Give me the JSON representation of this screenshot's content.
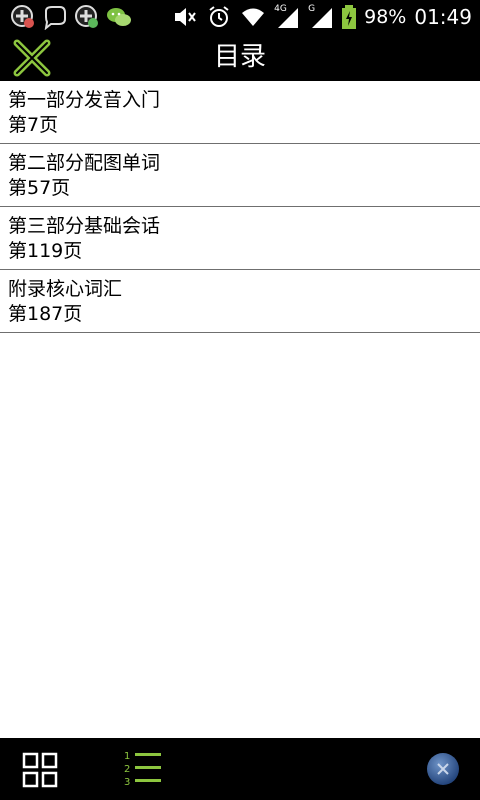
{
  "status_bar": {
    "battery": "98%",
    "time": "01:49",
    "network_4g": "4G",
    "network_g": "G"
  },
  "header": {
    "title": "目录",
    "close_icon": "close-x-icon"
  },
  "toc": {
    "items": [
      {
        "title": "第一部分发音入门",
        "page": "第7页"
      },
      {
        "title": "第二部分配图单词",
        "page": "第57页"
      },
      {
        "title": "第三部分基础会话",
        "page": "第119页"
      },
      {
        "title": "附录核心词汇",
        "page": "第187页"
      }
    ]
  },
  "bottom_bar": {
    "list_numbers": [
      "1",
      "2",
      "3"
    ]
  },
  "colors": {
    "accent": "#8dc63f",
    "bar_bg": "#000000",
    "divider": "#6f6f6f"
  }
}
